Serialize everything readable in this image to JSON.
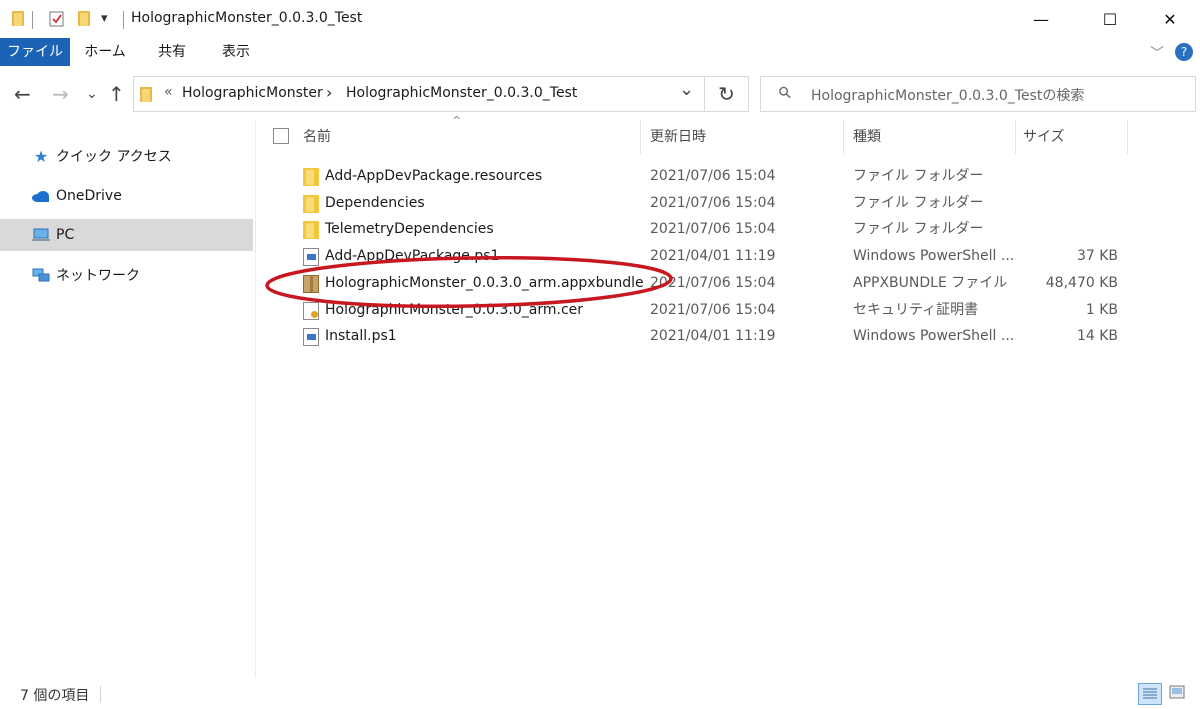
{
  "window": {
    "title": "HolographicMonster_0.0.3.0_Test",
    "minimize_glyph": "—",
    "maximize_glyph": "☐",
    "close_glyph": "✕"
  },
  "quick_access_toolbar": {
    "dropdown_glyph": "▾",
    "icons": [
      "folder-icon",
      "properties-icon",
      "new-folder-icon"
    ]
  },
  "ribbon": {
    "tabs": [
      "ファイル",
      "ホーム",
      "共有",
      "表示"
    ],
    "active_tab": "ファイル",
    "expand_glyph": "﹀",
    "help_glyph": "?"
  },
  "address_bar": {
    "overflow_glyph": "«",
    "breadcrumb": [
      "HolographicMonster",
      "HolographicMonster_0.0.3.0_Test"
    ],
    "separator_glyph": "›",
    "dropdown_glyph": "⌄",
    "refresh_glyph": "↻",
    "back_glyph": "←",
    "forward_glyph": "→",
    "recent_glyph": "⌄",
    "up_glyph": "↑"
  },
  "search": {
    "placeholder": "HolographicMonster_0.0.3.0_Testの検索",
    "icon": "search-icon",
    "glyph": "⚲"
  },
  "navigation_pane": {
    "items": [
      {
        "label": "クイック アクセス",
        "icon": "quick-access-star-icon"
      },
      {
        "label": "OneDrive",
        "icon": "onedrive-cloud-icon"
      },
      {
        "label": "PC",
        "icon": "pc-icon",
        "selected": true
      },
      {
        "label": "ネットワーク",
        "icon": "network-icon"
      }
    ]
  },
  "file_list": {
    "columns": {
      "name": "名前",
      "date": "更新日時",
      "type": "種類",
      "size": "サイズ"
    },
    "sort_glyph": "^",
    "rows": [
      {
        "name": "Add-AppDevPackage.resources",
        "date": "2021/07/06 15:04",
        "type": "ファイル フォルダー",
        "size": "",
        "icon": "folder-icon"
      },
      {
        "name": "Dependencies",
        "date": "2021/07/06 15:04",
        "type": "ファイル フォルダー",
        "size": "",
        "icon": "folder-icon"
      },
      {
        "name": "TelemetryDependencies",
        "date": "2021/07/06 15:04",
        "type": "ファイル フォルダー",
        "size": "",
        "icon": "folder-icon"
      },
      {
        "name": "Add-AppDevPackage.ps1",
        "date": "2021/04/01 11:19",
        "type": "Windows PowerShell ...",
        "size": "37 KB",
        "icon": "powershell-script-icon"
      },
      {
        "name": "HolographicMonster_0.0.3.0_arm.appxbundle",
        "date": "2021/07/06 15:04",
        "type": "APPXBUNDLE ファイル",
        "size": "48,470 KB",
        "icon": "package-icon",
        "highlighted": true
      },
      {
        "name": "HolographicMonster_0.0.3.0_arm.cer",
        "date": "2021/07/06 15:04",
        "type": "セキュリティ証明書",
        "size": "1 KB",
        "icon": "certificate-icon"
      },
      {
        "name": "Install.ps1",
        "date": "2021/04/01 11:19",
        "type": "Windows PowerShell ...",
        "size": "14 KB",
        "icon": "powershell-script-icon"
      }
    ]
  },
  "status_bar": {
    "item_count": "7 個の項目"
  },
  "colors": {
    "ribbon_active": "#1a63b5",
    "annotation_circle": "#c8171e",
    "nav_selected": "#d9d9d9"
  }
}
